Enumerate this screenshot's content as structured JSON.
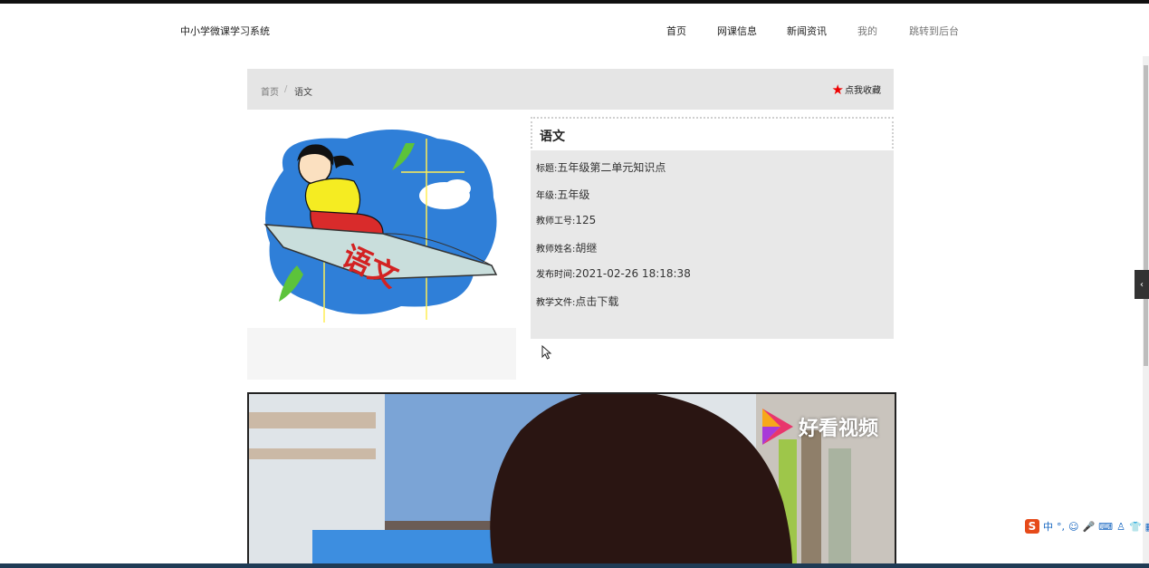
{
  "nav": {
    "brand": "中小学微课学习系统",
    "items": [
      {
        "label": "首页"
      },
      {
        "label": "网课信息"
      },
      {
        "label": "新闻资讯"
      },
      {
        "label": "我的"
      },
      {
        "label": "跳转到后台"
      }
    ]
  },
  "breadcrumb": {
    "home": "首页",
    "sep": "/",
    "current": "语文",
    "favorite": "点我收藏"
  },
  "detail": {
    "heading": "语文",
    "rows": [
      {
        "key": "标题:",
        "value": "五年级第二单元知识点"
      },
      {
        "key": "年级:",
        "value": "五年级"
      },
      {
        "key": "教师工号:",
        "value": "125"
      },
      {
        "key": "教师姓名:",
        "value": "胡继"
      },
      {
        "key": "发布时间:",
        "value": "2021-02-26 18:18:38"
      },
      {
        "key": "教学文件:",
        "value": "点击下载"
      }
    ]
  },
  "image_badge": "语文",
  "video": {
    "logo_text": "好看视频"
  },
  "ime": {
    "label": "中"
  },
  "colors": {
    "accent_star": "#e00000",
    "breadcrumb_bg": "#e5e5e5",
    "info_bg": "#e8e8e8"
  }
}
